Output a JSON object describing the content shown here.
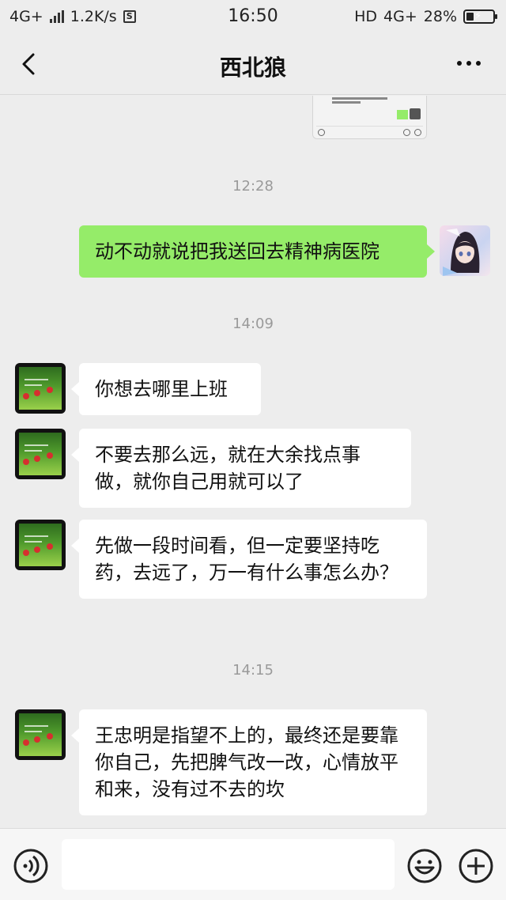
{
  "status_bar": {
    "network_left": "4G+",
    "speed": "1.2K/s",
    "time": "16:50",
    "hd": "HD",
    "network_right": "4G+",
    "battery": "28%",
    "battery_level": 0.28
  },
  "header": {
    "title": "西北狼",
    "back_icon": "chevron-left-icon",
    "more_icon": "more-dots-icon"
  },
  "messages": [
    {
      "type": "time",
      "text": "12:28"
    },
    {
      "type": "out",
      "text": "动不动就说把我送回去精神病医院"
    },
    {
      "type": "time",
      "text": "14:09"
    },
    {
      "type": "in",
      "text": "你想去哪里上班"
    },
    {
      "type": "in",
      "text": "不要去那么远，就在大余找点事做，就你自己用就可以了"
    },
    {
      "type": "in",
      "text": "先做一段时间看，但一定要坚持吃药，去远了，万一有什么事怎么办？"
    },
    {
      "type": "time",
      "text": "14:15"
    },
    {
      "type": "in",
      "text": "王忠明是指望不上的，最终还是要靠你自己，先把脾气改一改，心情放平和来，没有过不去的坎"
    }
  ],
  "input_bar": {
    "value": "",
    "placeholder": "",
    "voice_icon": "voice-icon",
    "emoji_icon": "emoji-icon",
    "plus_icon": "plus-icon"
  },
  "colors": {
    "background": "#ededed",
    "outgoing_bubble": "#95ec69",
    "incoming_bubble": "#ffffff",
    "timestamp": "#9a9a9a"
  }
}
